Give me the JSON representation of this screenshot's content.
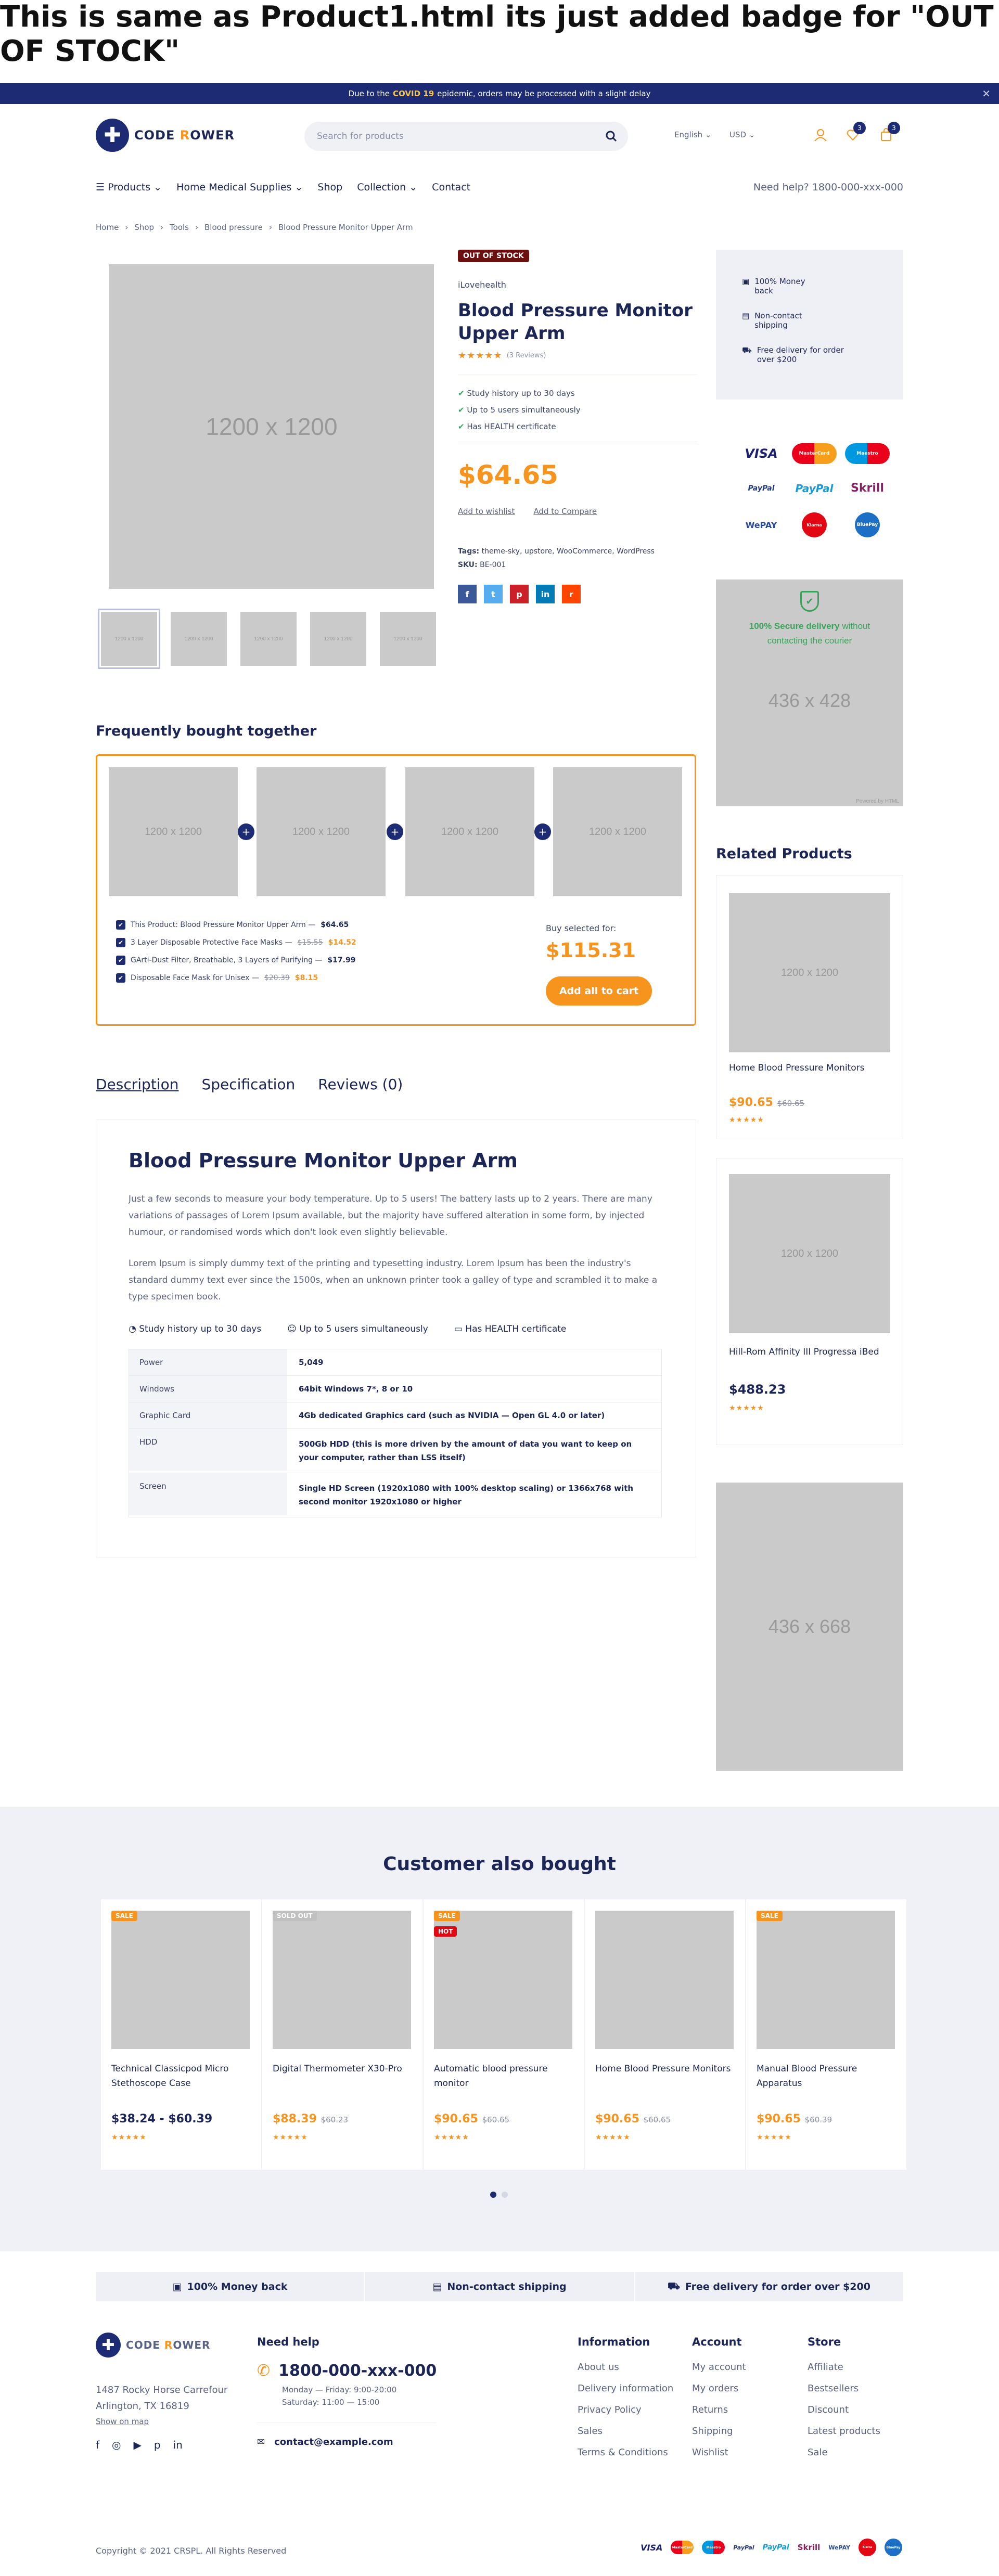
{
  "page_title": "This is same as Product1.html its just added badge for \"OUT OF STOCK\"",
  "topbar": {
    "prefix": "Due to the",
    "highlight": "COVID 19",
    "suffix": "epidemic, orders may be processed with a slight delay"
  },
  "header": {
    "logo_a": "C",
    "logo_b": "ODE ",
    "logo_c": "R",
    "logo_d": "OWER",
    "search_placeholder": "Search for products",
    "language": "English",
    "currency": "USD",
    "wishlist_count": "3",
    "cart_count": "3"
  },
  "nav": {
    "products": "Products",
    "home_medical": "Home Medical Supplies",
    "shop": "Shop",
    "collection": "Collection",
    "contact": "Contact",
    "help_label": "Need help?",
    "help_phone": "1800-000-xxx-000"
  },
  "breadcrumbs": [
    "Home",
    "Shop",
    "Tools",
    "Blood pressure",
    "Blood Pressure Monitor Upper Arm"
  ],
  "product": {
    "image_label": "1200 x 1200",
    "thumb_label": "1200 x 1200",
    "badge": "OUT OF STOCK",
    "brand": "iLovehealth",
    "name": "Blood Pressure Monitor Upper Arm",
    "rating": 5,
    "reviews": "(3 Reviews)",
    "features": [
      "Study history up to 30 days",
      "Up to 5 users simultaneously",
      "Has HEALTH certificate"
    ],
    "price": "$64.65",
    "add_wishlist": "Add to wishlist",
    "add_compare": "Add to Compare",
    "tags_label": "Tags:",
    "tags": "theme-sky,  upstore,  WooCommerce,  WordPress",
    "sku_label": "SKU:",
    "sku": "BE-001"
  },
  "sidebar": {
    "benefits": [
      {
        "icon": "box-icon",
        "text": "100% Money back"
      },
      {
        "icon": "package-icon",
        "text": "Non-contact shipping"
      },
      {
        "icon": "truck-icon",
        "text": "Free delivery for order over $200"
      }
    ],
    "payments": [
      "VISA",
      "MasterCard",
      "Maestro",
      "PayPal",
      "PayPal",
      "Skrill",
      "WePAY",
      "Klarna",
      "BluePay"
    ],
    "secure_green": "100% Secure delivery",
    "secure_rest": "without contacting the courier",
    "banner_label": "436 x 428",
    "tall_banner": "436 x 668",
    "powered": "Powered by HTML"
  },
  "fbt": {
    "title": "Frequently bought together",
    "image_label": "1200 x 1200",
    "items": [
      {
        "text": "This Product: Blood Pressure Monitor Upper Arm —",
        "old": "",
        "price": "$64.65"
      },
      {
        "text": "3 Layer Disposable Protective Face Masks —",
        "old": "$15.55",
        "price": "$14.52"
      },
      {
        "text": "GArti-Dust Filter, Breathable, 3 Layers of Purifying —",
        "old": "",
        "price": "$17.99"
      },
      {
        "text": "Disposable Face Mask for Unisex —",
        "old": "$20.39",
        "price": "$8.15"
      }
    ],
    "buy_label": "Buy selected for:",
    "total": "$115.31",
    "button": "Add all to cart"
  },
  "tabs": [
    "Description",
    "Specification",
    "Reviews (0)"
  ],
  "description": {
    "title": "Blood Pressure Monitor Upper Arm",
    "p1": "Just a few seconds to measure your body temperature. Up to 5 users! The battery lasts up to 2 years. There are many variations of passages of Lorem Ipsum available, but the majority have suffered alteration in some form, by injected humour, or randomised words which don't look even slightly believable.",
    "p2": "Lorem Ipsum is simply dummy text of the printing and typesetting industry. Lorem Ipsum has been the industry's standard dummy text ever since the 1500s, when an unknown printer took a galley of type and scrambled it to make a type specimen book.",
    "features": [
      "Study history up to 30 days",
      "Up to 5 users simultaneously",
      "Has HEALTH certificate"
    ],
    "specs": [
      {
        "k": "Power",
        "v": "5,049"
      },
      {
        "k": "Windows",
        "v": "64bit Windows 7*, 8 or 10"
      },
      {
        "k": "Graphic Card",
        "v": "4Gb dedicated Graphics card (such as NVIDIA — Open GL 4.0 or later)"
      },
      {
        "k": "HDD",
        "v": "500Gb HDD (this is more driven by the amount of data you want to keep on your computer, rather than LSS itself)"
      },
      {
        "k": "Screen",
        "v": "Single HD Screen (1920x1080 with 100% desktop scaling) or 1366x768 with second monitor 1920x1080 or higher"
      }
    ]
  },
  "related": {
    "title": "Related Products",
    "items": [
      {
        "img": "1200 x 1200",
        "name": "Home Blood Pressure Monitors",
        "price": "$90.65",
        "old": "$60.65"
      },
      {
        "img": "1200 x 1200",
        "name": "Hill-Rom Affinity III Progressa iBed",
        "price": "$488.23",
        "old": ""
      }
    ]
  },
  "customer_bought": {
    "title": "Customer also bought",
    "items": [
      {
        "name": "Technical Classicpod Micro Stethoscope Case",
        "price": "$38.24 - $60.39",
        "old": "",
        "tags": [
          "SALE"
        ]
      },
      {
        "name": "Digital Thermometer X30-Pro",
        "price": "$88.39",
        "old": "$60.23",
        "tags": [
          "SOLD OUT"
        ]
      },
      {
        "name": "Automatic blood pressure monitor",
        "price": "$90.65",
        "old": "$60.65",
        "tags": [
          "SALE",
          "HOT"
        ]
      },
      {
        "name": "Home Blood Pressure Monitors",
        "price": "$90.65",
        "old": "$60.65",
        "tags": []
      },
      {
        "name": "Manual Blood Pressure Apparatus",
        "price": "$90.65",
        "old": "$60.39",
        "tags": [
          "SALE"
        ]
      }
    ]
  },
  "footer": {
    "bar": [
      "100% Money back",
      "Non-contact shipping",
      "Free delivery for order over $200"
    ],
    "address1": "1487 Rocky Horse Carrefour",
    "address2": "Arlington, TX 16819",
    "map_link": "Show on map",
    "need_help": "Need help",
    "phone": "1800-000-xxx-000",
    "hours1": "Monday — Friday: 9:00-20:00",
    "hours2": "Saturday: 11:00 — 15:00",
    "email": "contact@example.com",
    "information": {
      "title": "Information",
      "links": [
        "About us",
        "Delivery information",
        "Privacy Policy",
        "Sales",
        "Terms & Conditions"
      ]
    },
    "account": {
      "title": "Account",
      "links": [
        "My account",
        "My orders",
        "Returns",
        "Shipping",
        "Wishlist"
      ]
    },
    "store": {
      "title": "Store",
      "links": [
        "Affiliate",
        "Bestsellers",
        "Discount",
        "Latest products",
        "Sale"
      ]
    },
    "copyright": "Copyright © 2021 CRSPL. All Rights Reserved"
  },
  "colors": {
    "navy": "#1c2b74",
    "orange": "#f7941d",
    "green": "#3aa35b",
    "oos_badge": "#6b0f0f"
  }
}
